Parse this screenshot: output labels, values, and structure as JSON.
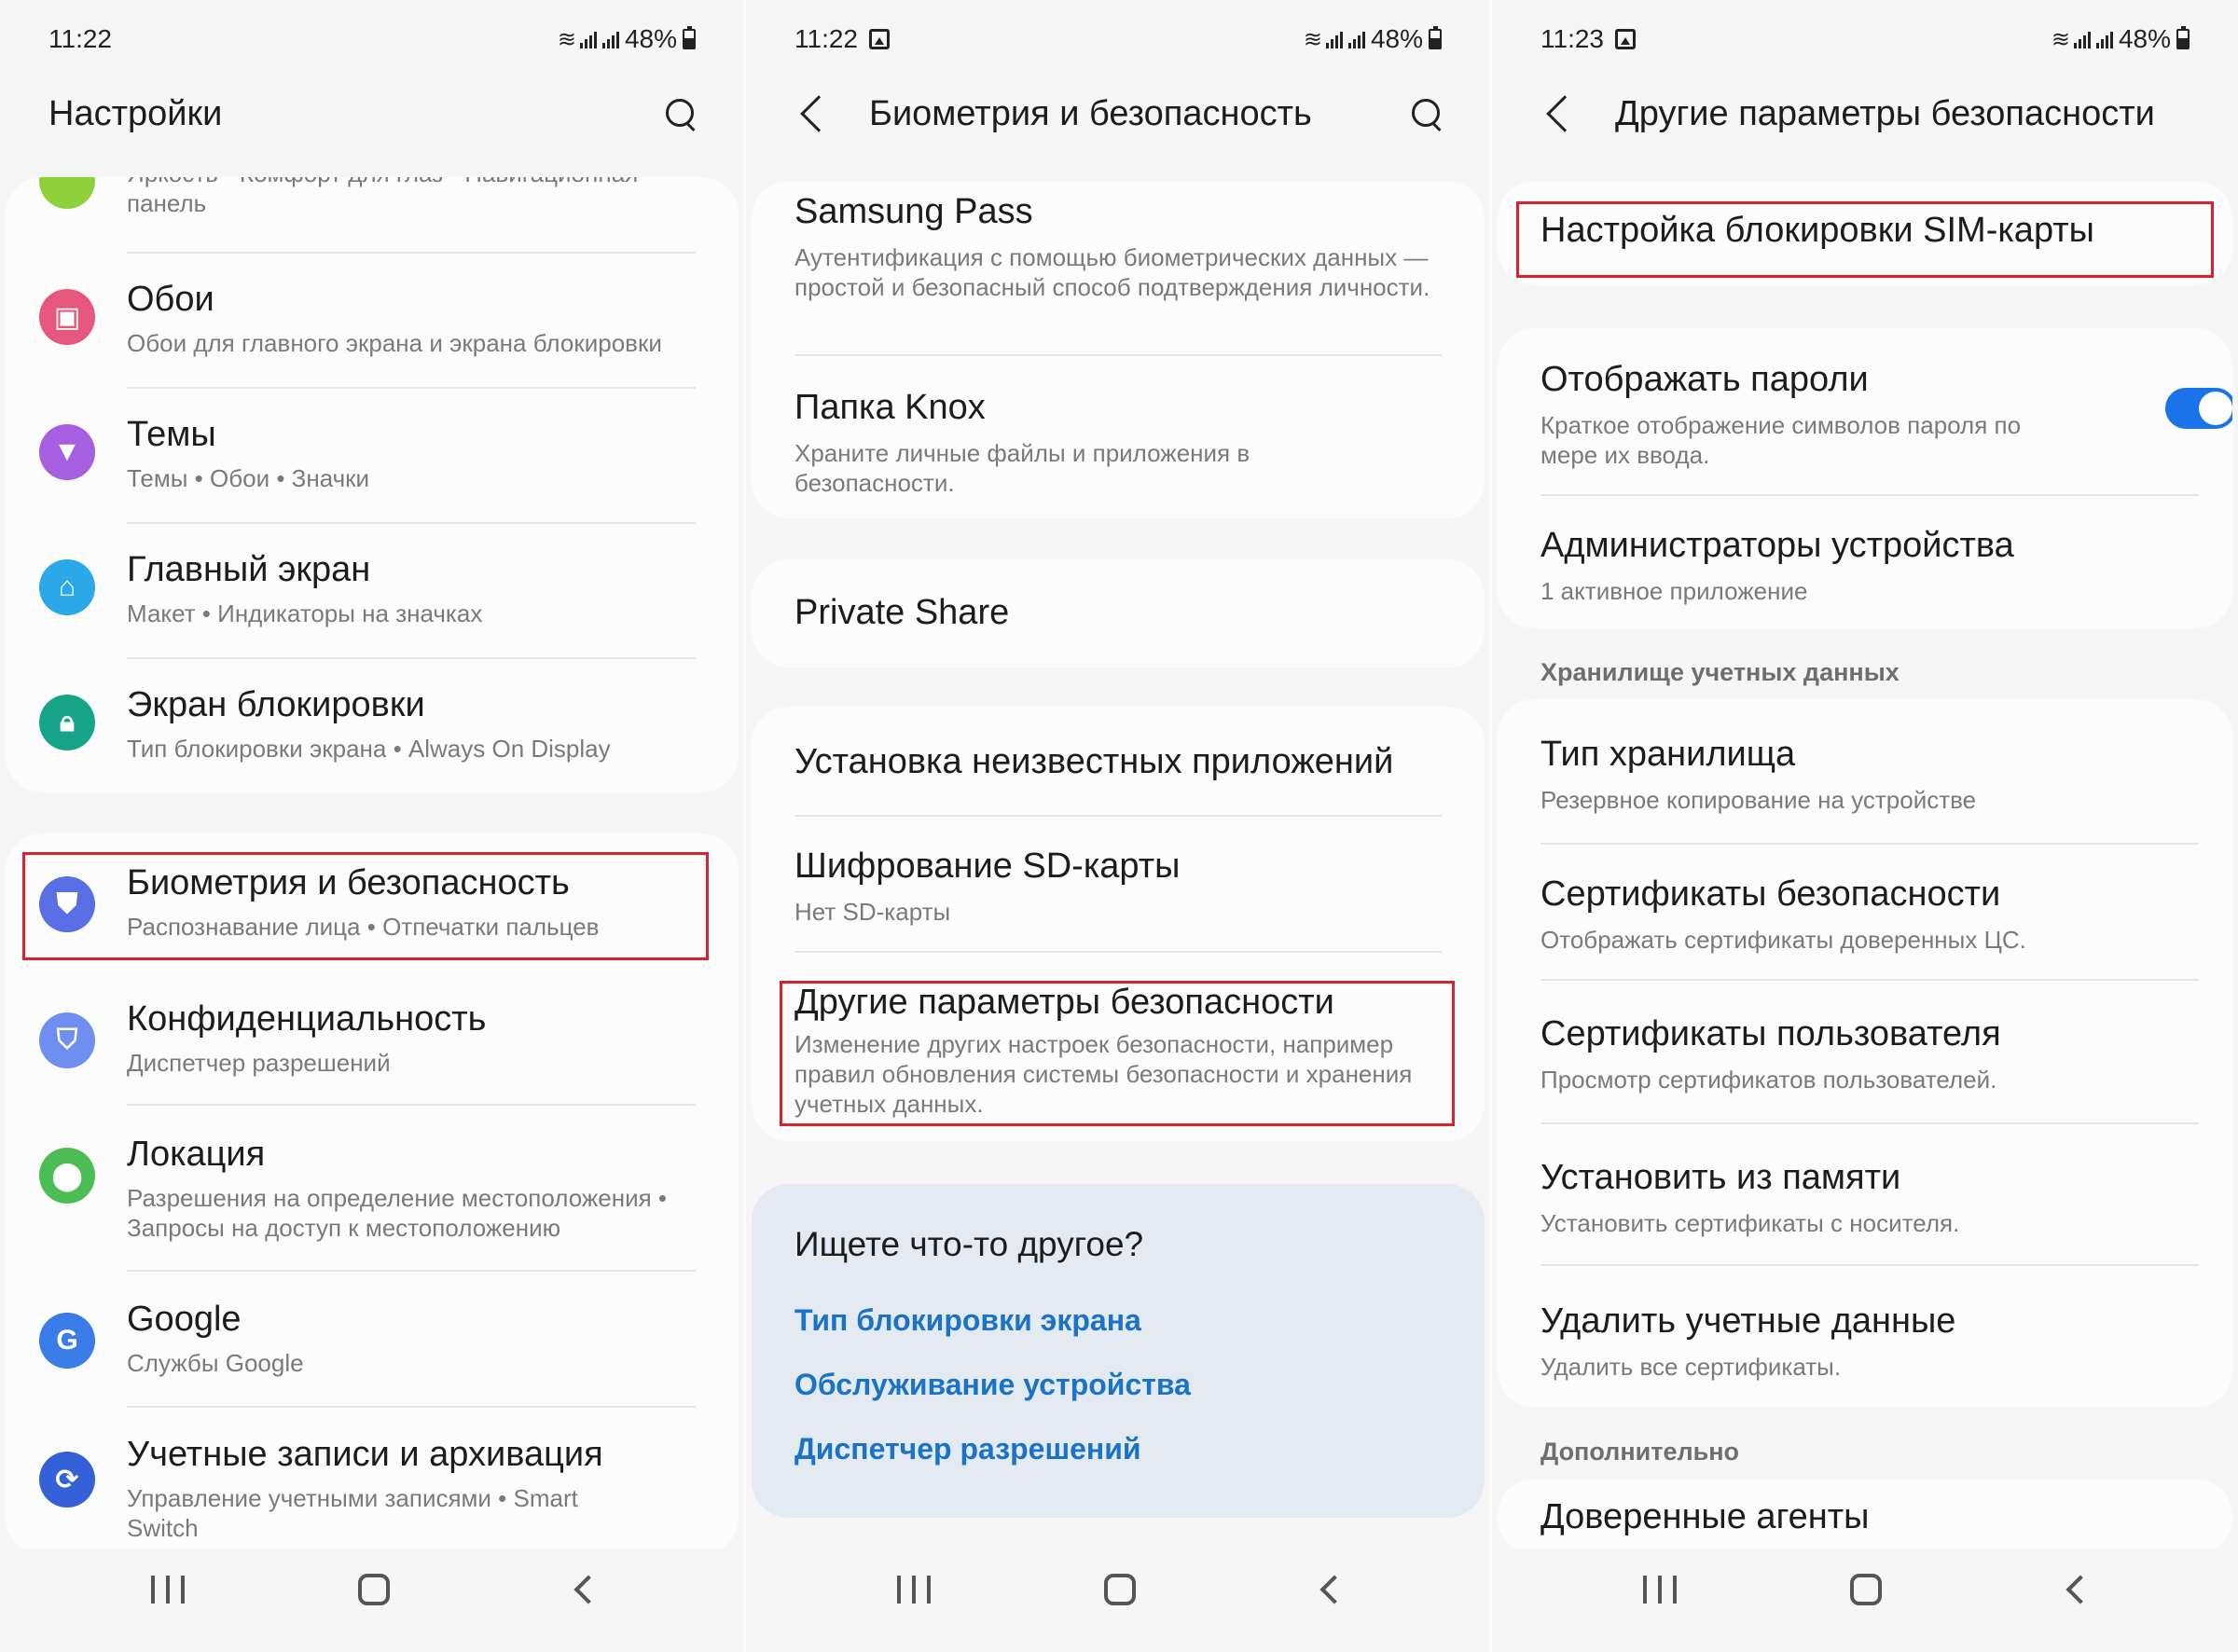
{
  "status_bars": [
    {
      "time": "11:22",
      "battery": "48%"
    },
    {
      "time": "11:22",
      "battery": "48%"
    },
    {
      "time": "11:23",
      "battery": "48%"
    }
  ],
  "screen1": {
    "title": "Настройки",
    "partial_top": "Яркость · Комфорт для глаз · Навигационная",
    "partial_top_2": "панель",
    "items": [
      {
        "title": "Обои",
        "subtitle": "Обои для главного экрана и экрана блокировки",
        "color": "#e5577c"
      },
      {
        "title": "Темы",
        "subtitle": "Темы • Обои • Значки",
        "color": "#a65fe0"
      },
      {
        "title": "Главный экран",
        "subtitle": "Макет • Индикаторы на значках",
        "color": "#2aa8e8"
      },
      {
        "title": "Экран блокировки",
        "subtitle": "Тип блокировки экрана • Always On Display",
        "color": "#17a58a"
      },
      {
        "title": "Биометрия и безопасность",
        "subtitle": "Распознавание лица • Отпечатки пальцев",
        "color": "#5a6ee6"
      },
      {
        "title": "Конфиденциальность",
        "subtitle": "Диспетчер разрешений",
        "color": "#6e8ef0"
      },
      {
        "title": "Локация",
        "subtitle": "Разрешения на определение местоположения • Запросы на доступ к местоположению",
        "color": "#4cbc54"
      },
      {
        "title": "Google",
        "subtitle": "Службы Google",
        "color": "#3b7de8"
      },
      {
        "title": "Учетные записи и архивация",
        "subtitle": "Управление учетными записями • Smart Switch",
        "color": "#3561d8"
      }
    ]
  },
  "screen2": {
    "title": "Биометрия и безопасность",
    "items": [
      {
        "title": "Samsung Pass",
        "subtitle": "Аутентификация с помощью биометрических данных — простой и безопасный способ подтверждения личности."
      },
      {
        "title": "Папка Knox",
        "subtitle": "Храните личные файлы и приложения в безопасности."
      },
      {
        "title": "Private Share",
        "subtitle": ""
      },
      {
        "title": "Установка неизвестных приложений",
        "subtitle": ""
      },
      {
        "title": "Шифрование SD-карты",
        "subtitle": "Нет SD-карты"
      },
      {
        "title": "Другие параметры безопасности",
        "subtitle": "Изменение других настроек безопасности, например правил обновления системы безопасности и хранения учетных данных."
      }
    ],
    "suggest": {
      "heading": "Ищете что-то другое?",
      "links": [
        "Тип блокировки экрана",
        "Обслуживание устройства",
        "Диспетчер разрешений"
      ]
    }
  },
  "screen3": {
    "title": "Другие параметры безопасности",
    "sim_lock": "Настройка блокировки SIM-карты",
    "show_passwords": {
      "title": "Отображать пароли",
      "subtitle": "Краткое отображение символов пароля по мере их ввода.",
      "enabled": true
    },
    "device_admins": {
      "title": "Администраторы устройства",
      "subtitle": "1 активное приложение"
    },
    "section_storage": "Хранилище учетных данных",
    "storage_items": [
      {
        "title": "Тип хранилища",
        "subtitle": "Резервное копирование на устройстве"
      },
      {
        "title": "Сертификаты безопасности",
        "subtitle": "Отображать сертификаты доверенных ЦС."
      },
      {
        "title": "Сертификаты пользователя",
        "subtitle": "Просмотр сертификатов пользователей."
      },
      {
        "title": "Установить из памяти",
        "subtitle": "Установить сертификаты с носителя."
      },
      {
        "title": "Удалить учетные данные",
        "subtitle": "Удалить все сертификаты."
      }
    ],
    "section_extra": "Дополнительно",
    "trusted_agents": "Доверенные агенты"
  },
  "colors": {
    "accent": "#1a73e8",
    "highlight": "#d8232a",
    "link": "#1a73c9"
  }
}
